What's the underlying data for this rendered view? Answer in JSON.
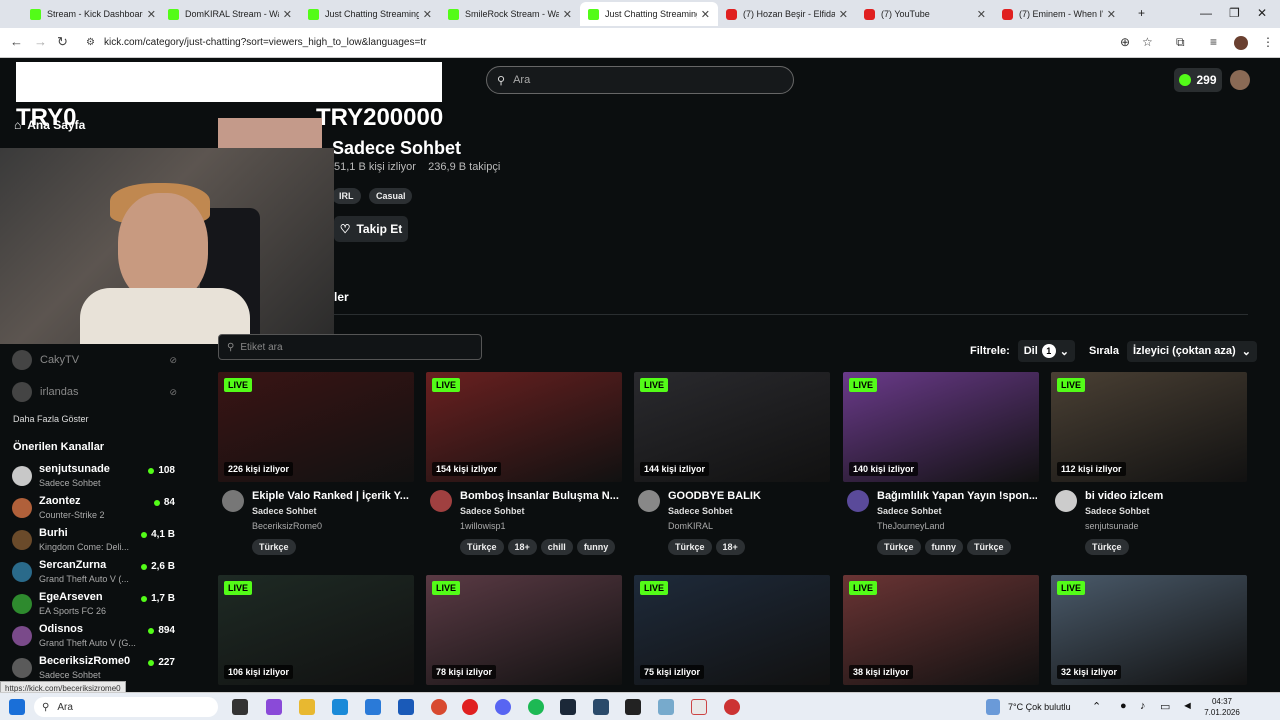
{
  "tabs": [
    {
      "title": "Stream - Kick Dashboard",
      "icon": "kick",
      "active": false
    },
    {
      "title": "DomKIRAL Stream - Watc",
      "icon": "kick",
      "active": false
    },
    {
      "title": "Just Chatting Streaming",
      "icon": "kick",
      "active": false
    },
    {
      "title": "SmileRock Stream - Watc",
      "icon": "kick",
      "active": false
    },
    {
      "title": "Just Chatting Streaming -",
      "icon": "kick",
      "active": true
    },
    {
      "title": "(7) Hozan Beşir - Elfida - Y",
      "icon": "youtube",
      "active": false
    },
    {
      "title": "(7) YouTube",
      "icon": "youtube",
      "active": false
    },
    {
      "title": "(7) Eminem - When I'm G",
      "icon": "youtube",
      "active": false
    }
  ],
  "address": {
    "url": "kick.com/category/just-chatting?sort=viewers_high_to_low&languages=tr"
  },
  "overlay": {
    "try_left": "TRY0",
    "try_right": "TRY200000"
  },
  "header": {
    "search_placeholder": "Ara",
    "coins": "299"
  },
  "sidebar": {
    "home": "Ana Sayfa",
    "offline": [
      {
        "name": "CakyTV"
      },
      {
        "name": "irlandas"
      }
    ],
    "show_more": "Daha Fazla Göster",
    "recommended_title": "Önerilen Kanallar",
    "recommended": [
      {
        "name": "senjutsunade",
        "game": "Sadece Sohbet",
        "viewers": "108",
        "color": "#c8c8c8"
      },
      {
        "name": "Zaontez",
        "game": "Counter-Strike 2",
        "viewers": "84",
        "color": "#b0603a"
      },
      {
        "name": "Burhi",
        "game": "Kingdom Come: Deli...",
        "viewers": "4,1 B",
        "color": "#6a4a2a"
      },
      {
        "name": "SercanZurna",
        "game": "Grand Theft Auto V (...",
        "viewers": "2,6 B",
        "color": "#2a6a8a"
      },
      {
        "name": "EgeArseven",
        "game": "EA Sports FC 26",
        "viewers": "1,7 B",
        "color": "#2e8a2e"
      },
      {
        "name": "Odisnos",
        "game": "Grand Theft Auto V (G...",
        "viewers": "894",
        "color": "#7a4a8a"
      },
      {
        "name": "BeceriksizRome0",
        "game": "Sadece Sohbet",
        "viewers": "227",
        "color": "#5a5a5a"
      }
    ]
  },
  "category": {
    "title": "Sadece Sohbet",
    "viewers": "51,1 B kişi izliyor",
    "followers": "236,9 B takipçi",
    "tags": [
      "IRL",
      "Casual"
    ],
    "follow_label": "Takip Et",
    "section_title": "ler"
  },
  "filters": {
    "tag_search_placeholder": "Etiket ara",
    "filter_label": "Filtrele:",
    "language_label": "Dil",
    "language_count": "1",
    "sort_label": "Sırala",
    "sort_value": "İzleyici (çoktan aza)"
  },
  "live_label": "LIVE",
  "streams": [
    {
      "viewers": "226 kişi izliyor",
      "title": "Ekiple Valo Ranked | İçerik Y...",
      "category": "Sadece Sohbet",
      "user": "BeceriksizRome0",
      "tags": [
        "Türkçe"
      ],
      "thumb": "#3a1414",
      "avatar": "#777"
    },
    {
      "viewers": "154 kişi izliyor",
      "title": "Bomboş İnsanlar Buluşma N...",
      "category": "Sadece Sohbet",
      "user": "1willowisp1",
      "tags": [
        "Türkçe",
        "18+",
        "chill",
        "funny"
      ],
      "thumb": "#6a2020",
      "avatar": "#a04040"
    },
    {
      "viewers": "144 kişi izliyor",
      "title": "GOODBYE BALIK",
      "category": "Sadece Sohbet",
      "user": "DomKIRAL",
      "tags": [
        "Türkçe",
        "18+"
      ],
      "thumb": "#2a2a2e",
      "avatar": "#888"
    },
    {
      "viewers": "140 kişi izliyor",
      "title": "Bağımlılık Yapan Yayın !spon...",
      "category": "Sadece Sohbet",
      "user": "TheJourneyLand",
      "tags": [
        "Türkçe",
        "funny",
        "Türkçe"
      ],
      "thumb": "#6a3a8a",
      "avatar": "#5a4a9a"
    },
    {
      "viewers": "112 kişi izliyor",
      "title": "bi video izlcem",
      "category": "Sadece Sohbet",
      "user": "senjutsunade",
      "tags": [
        "Türkçe"
      ],
      "thumb": "#4a4034",
      "avatar": "#ccc"
    },
    {
      "viewers": "106 kişi izliyor",
      "title": "",
      "category": "",
      "user": "",
      "tags": [],
      "thumb": "#1e2a24",
      "avatar": ""
    },
    {
      "viewers": "78 kişi izliyor",
      "title": "",
      "category": "",
      "user": "",
      "tags": [],
      "thumb": "#5a3a44",
      "avatar": ""
    },
    {
      "viewers": "75 kişi izliyor",
      "title": "",
      "category": "",
      "user": "",
      "tags": [],
      "thumb": "#1e2a3a",
      "avatar": ""
    },
    {
      "viewers": "38 kişi izliyor",
      "title": "",
      "category": "",
      "user": "",
      "tags": [],
      "thumb": "#6a3434",
      "avatar": ""
    },
    {
      "viewers": "32 kişi izliyor",
      "title": "",
      "category": "",
      "user": "",
      "tags": [],
      "thumb": "#4a5a6a",
      "avatar": ""
    }
  ],
  "status_url": "https://kick.com/beceriksizrome0",
  "taskbar": {
    "search": "Ara",
    "weather": "7°C  Çok bulutlu",
    "time": "04:37",
    "date": "7.01.2026"
  }
}
